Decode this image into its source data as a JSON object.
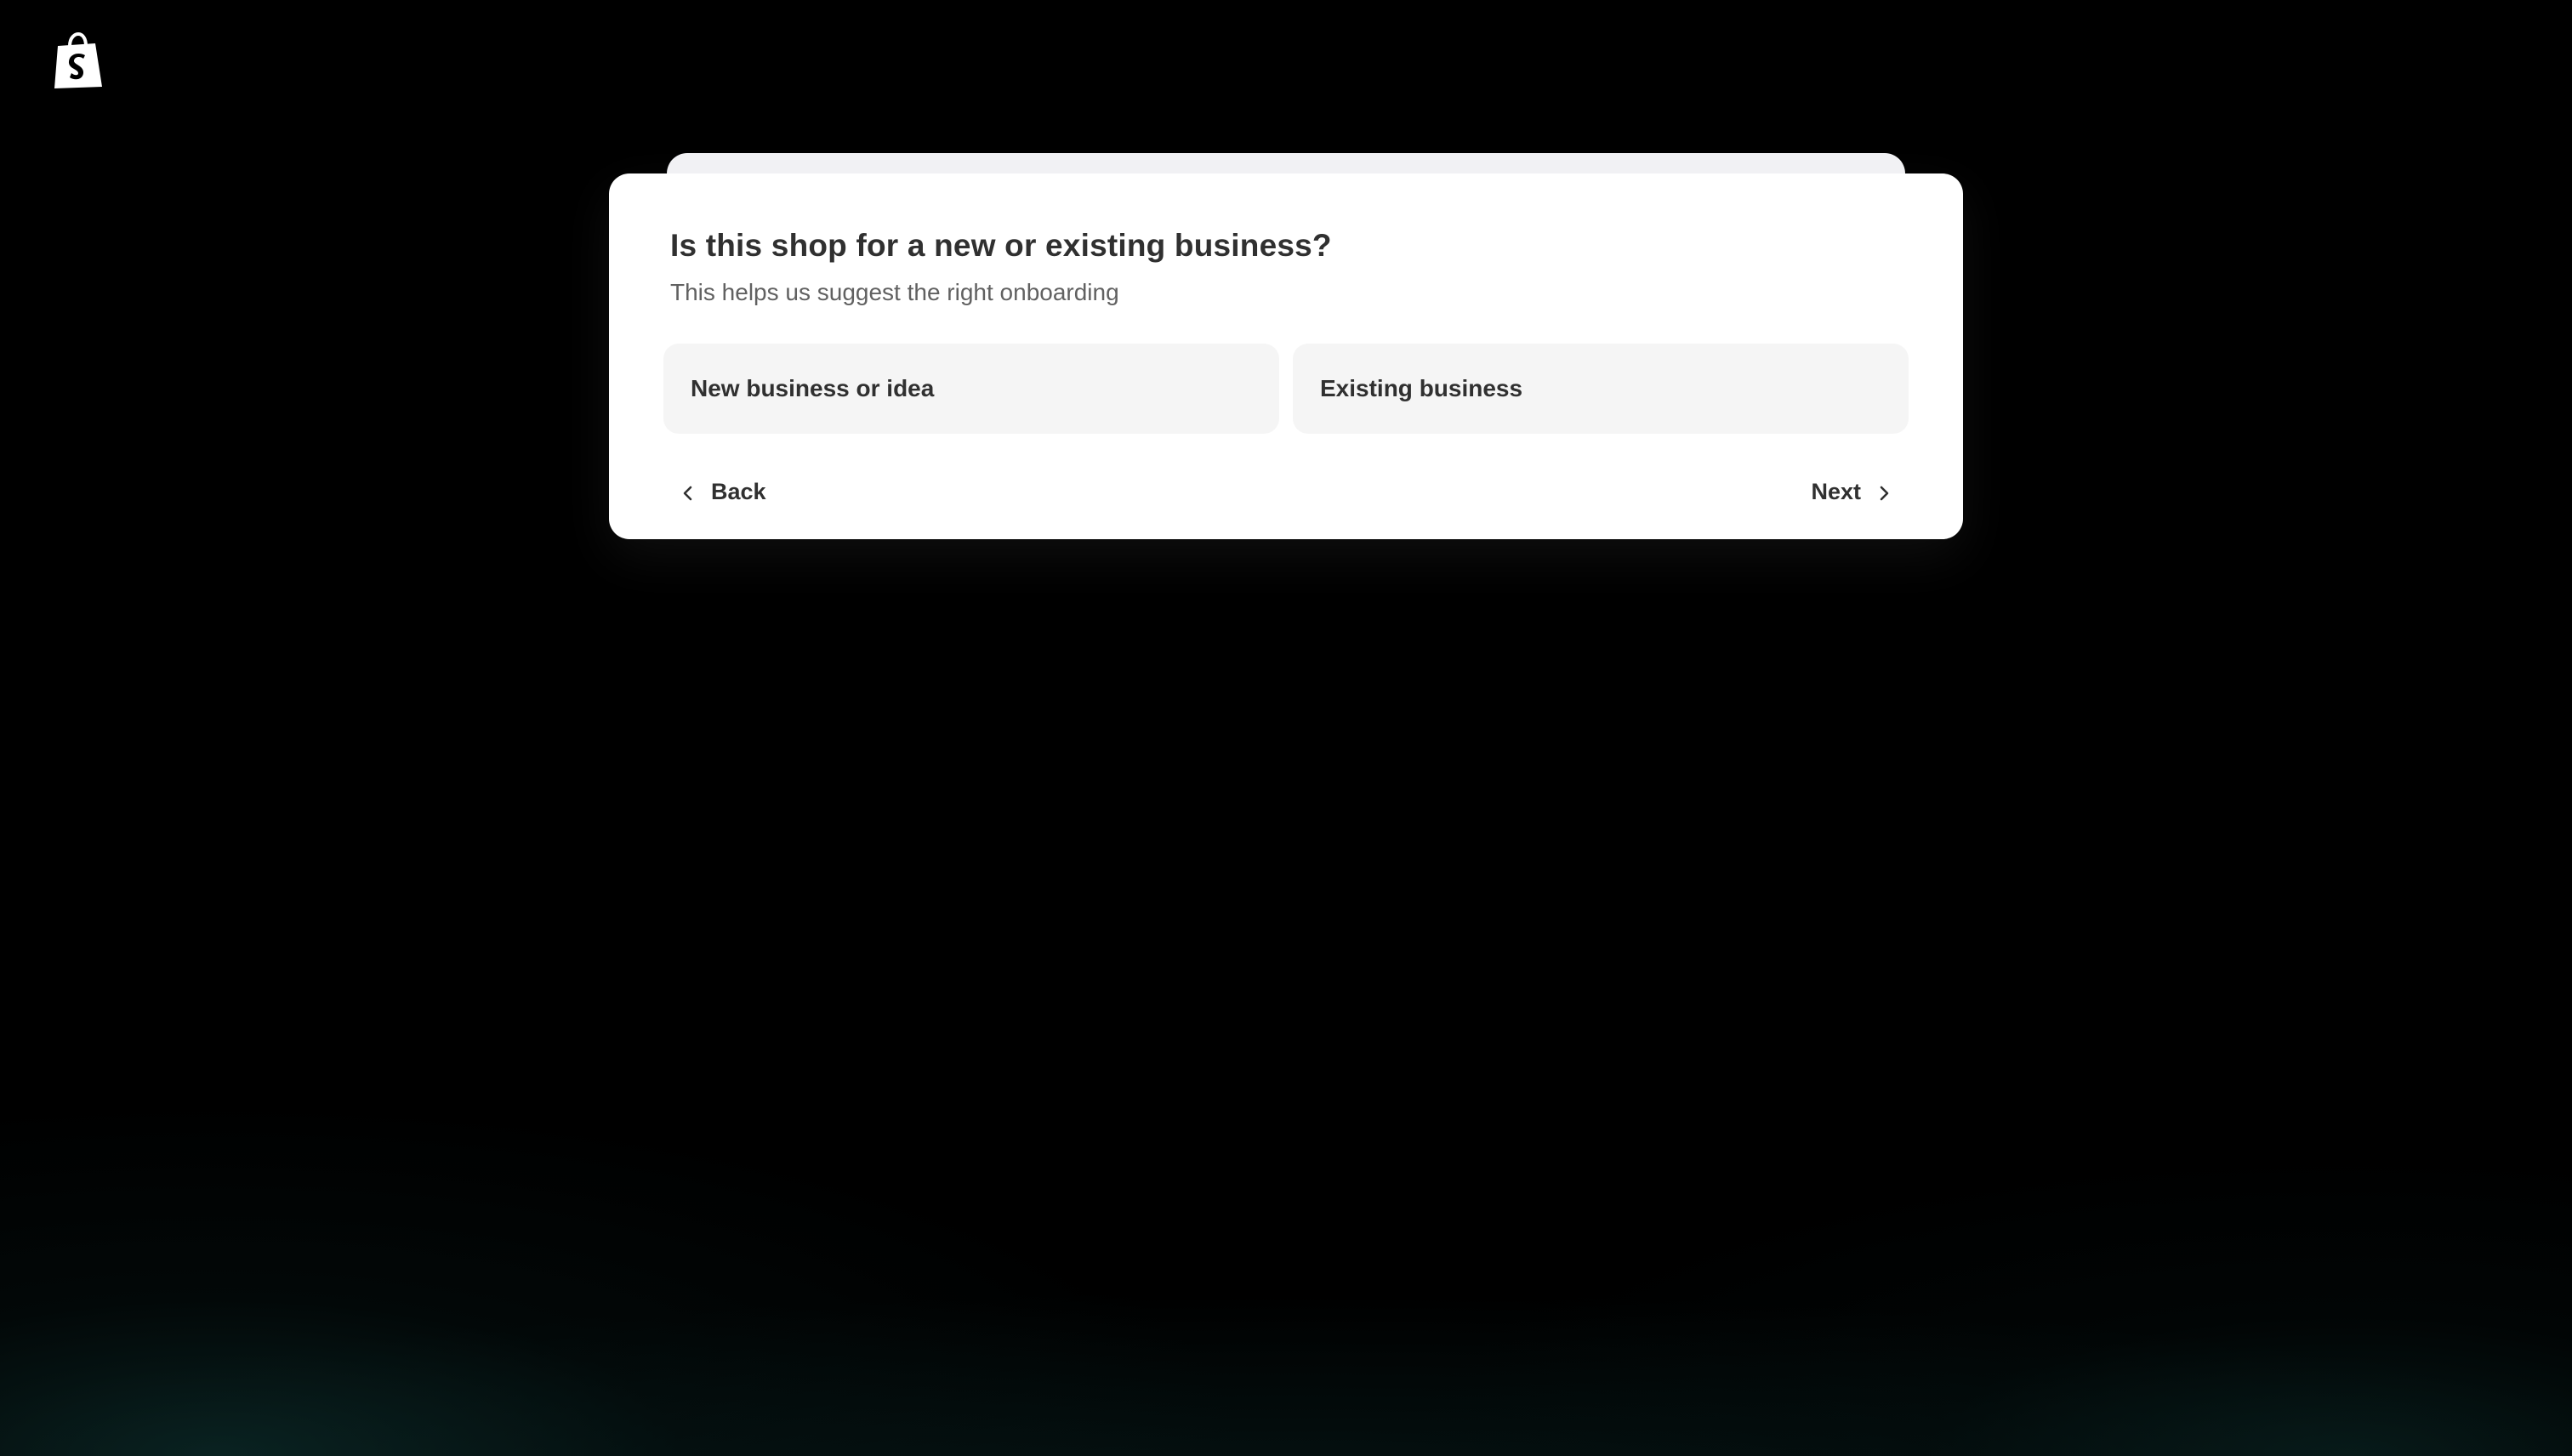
{
  "brand": {
    "logo_icon": "shopify-bag-icon",
    "logo_letter": "S"
  },
  "question": {
    "title": "Is this shop for a new or existing business?",
    "subtitle": "This helps us suggest the right onboarding"
  },
  "options": [
    {
      "label": "New business or idea"
    },
    {
      "label": "Existing business"
    }
  ],
  "navigation": {
    "back_label": "Back",
    "back_icon": "chevron-left-icon",
    "next_label": "Next",
    "next_icon": "chevron-right-icon"
  },
  "colors": {
    "background": "#000000",
    "card": "#ffffff",
    "option_background": "#f5f5f5",
    "text_primary": "#303030",
    "text_secondary": "#616161"
  }
}
